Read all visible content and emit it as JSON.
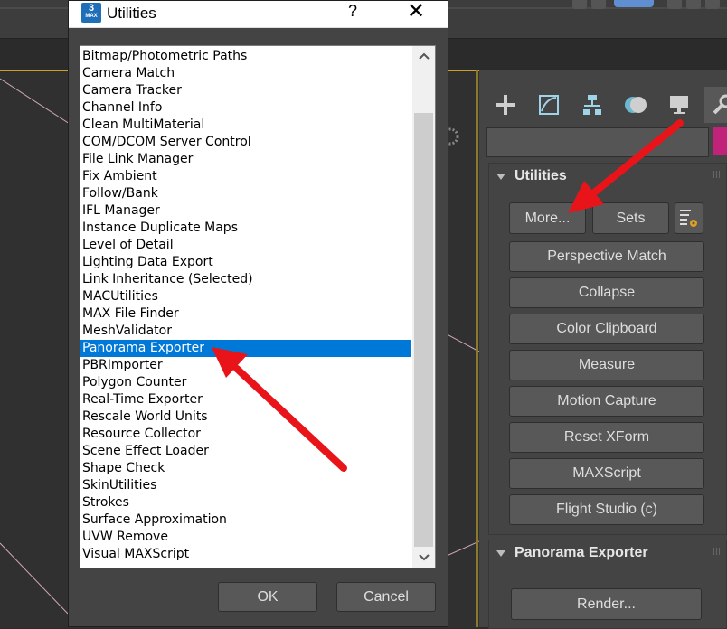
{
  "dialog": {
    "title": "Utilities",
    "app_icon_main": "3",
    "app_icon_sub": "MAX",
    "help_label": "?",
    "close_label": "✕",
    "ok_label": "OK",
    "cancel_label": "Cancel",
    "items": [
      "Bitmap/Photometric Paths",
      "Camera Match",
      "Camera Tracker",
      "Channel Info",
      "Clean MultiMaterial",
      "COM/DCOM Server Control",
      "File Link Manager",
      "Fix Ambient",
      "Follow/Bank",
      "IFL Manager",
      "Instance Duplicate Maps",
      "Level of Detail",
      "Lighting Data Export",
      "Link Inheritance (Selected)",
      "MACUtilities",
      "MAX File Finder",
      "MeshValidator",
      "Panorama Exporter",
      "PBRImporter",
      "Polygon Counter",
      "Real-Time Exporter",
      "Rescale World Units",
      "Resource Collector",
      "Scene Effect Loader",
      "Shape Check",
      "SkinUtilities",
      "Strokes",
      "Surface Approximation",
      "UVW Remove",
      "Visual MAXScript"
    ],
    "selected_item": "Panorama Exporter"
  },
  "command_panel": {
    "tabs": [
      "create-icon",
      "modify-icon",
      "hierarchy-icon",
      "motion-icon",
      "display-icon",
      "utilities-icon"
    ],
    "active_tab": "utilities-icon",
    "object_color": "#c1237a",
    "utilities_rollout": {
      "title": "Utilities",
      "more_label": "More...",
      "sets_label": "Sets",
      "buttons": [
        "Perspective Match",
        "Collapse",
        "Color Clipboard",
        "Measure",
        "Motion Capture",
        "Reset XForm",
        "MAXScript",
        "Flight Studio (c)"
      ]
    },
    "panorama_rollout": {
      "title": "Panorama Exporter",
      "render_label": "Render..."
    }
  },
  "colors": {
    "selection": "#0078d7",
    "annotation_arrow": "#e8141a",
    "panel_bg": "#444444"
  }
}
